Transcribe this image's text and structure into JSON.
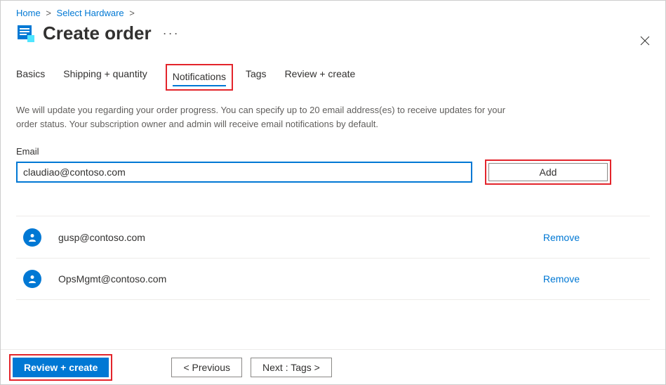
{
  "breadcrumb": {
    "home": "Home",
    "select_hardware": "Select Hardware"
  },
  "header": {
    "title": "Create order",
    "more": "···"
  },
  "tabs": {
    "basics": "Basics",
    "shipping": "Shipping + quantity",
    "notifications": "Notifications",
    "tags": "Tags",
    "review": "Review + create"
  },
  "description": "We will update you regarding your order progress. You can specify up to 20 email address(es) to receive updates for your order status. Your subscription owner and admin will receive email notifications by default.",
  "email": {
    "label": "Email",
    "value": "claudiao@contoso.com",
    "add_label": "Add"
  },
  "recipients": [
    {
      "address": "gusp@contoso.com",
      "remove": "Remove"
    },
    {
      "address": "OpsMgmt@contoso.com",
      "remove": "Remove"
    }
  ],
  "footer": {
    "review_create": "Review + create",
    "previous": "< Previous",
    "next": "Next : Tags >"
  }
}
